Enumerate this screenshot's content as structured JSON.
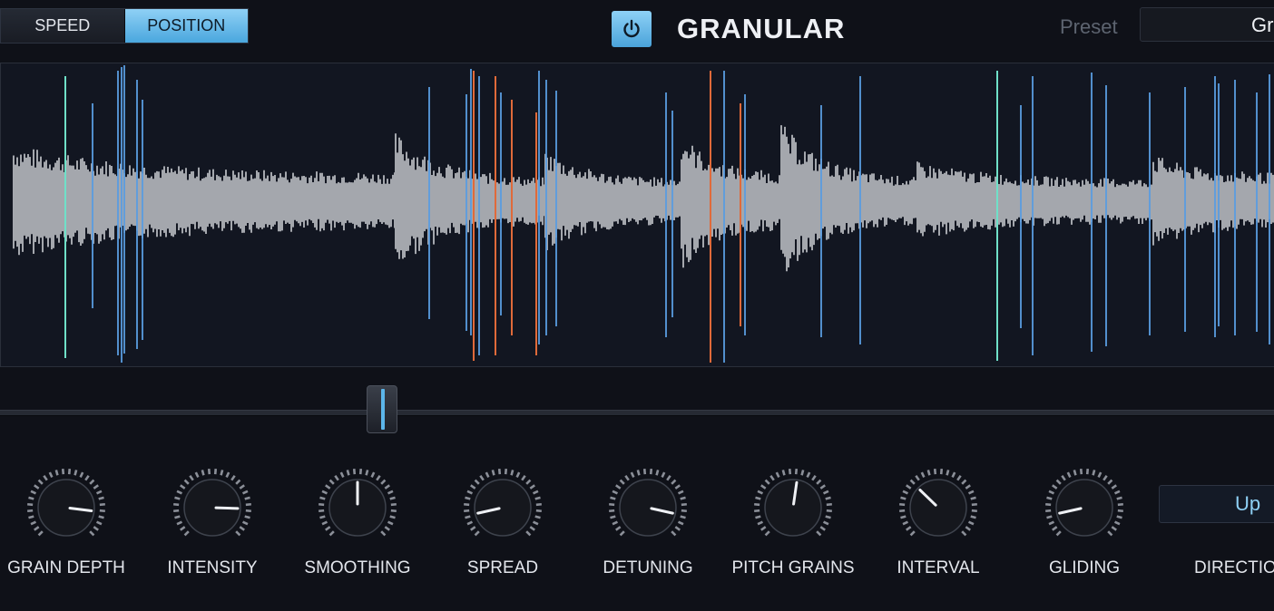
{
  "header": {
    "mode_speed_label": "SPEED",
    "mode_position_label": "POSITION",
    "active_mode": "POSITION",
    "power_icon": "power-icon",
    "title": "GRANULAR",
    "preset_label": "Preset",
    "preset_value": "Gr"
  },
  "position_slider": {
    "value": 0.3
  },
  "knobs": [
    {
      "label": "GRAIN DEPTH",
      "value": 0.86
    },
    {
      "label": "INTENSITY",
      "value": 0.84
    },
    {
      "label": "SMOOTHING",
      "value": 0.5
    },
    {
      "label": "SPREAD",
      "value": 0.12
    },
    {
      "label": "DETUNING",
      "value": 0.88
    },
    {
      "label": "PITCH GRAINS",
      "value": 0.53
    },
    {
      "label": "INTERVAL",
      "value": 0.33
    },
    {
      "label": "GLIDING",
      "value": 0.12
    }
  ],
  "direction": {
    "label": "DIRECTIO",
    "value": "Up"
  },
  "colors": {
    "accent": "#4aa7de",
    "waveform": "#a4a7ad",
    "grain_blue": "#5a9de0",
    "grain_orange": "#e06a3a",
    "grain_teal": "#6fe0c8"
  }
}
